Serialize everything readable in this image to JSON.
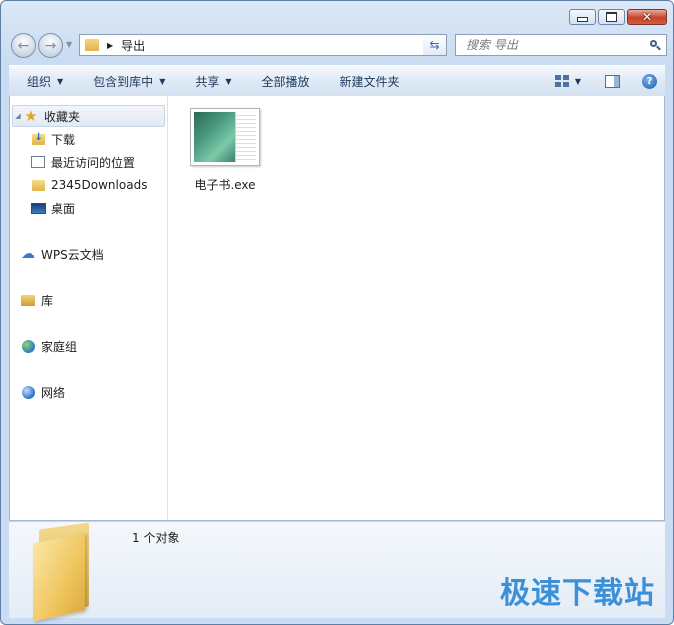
{
  "window": {
    "caption": {
      "minimize": "minimize",
      "maximize": "maximize",
      "close": "close"
    }
  },
  "navbar": {
    "breadcrumb": "导出",
    "search_placeholder": "搜索 导出"
  },
  "toolbar": {
    "organize": "组织",
    "include_in_library": "包含到库中",
    "share": "共享",
    "play_all": "全部播放",
    "new_folder": "新建文件夹",
    "help": "?"
  },
  "sidebar": {
    "favorites": "收藏夹",
    "favorites_items": [
      {
        "label": "下载",
        "icon": "download-folder-icon"
      },
      {
        "label": "最近访问的位置",
        "icon": "recent-places-icon"
      },
      {
        "label": "2345Downloads",
        "icon": "folder-icon"
      },
      {
        "label": "桌面",
        "icon": "desktop-icon"
      }
    ],
    "groups": [
      {
        "label": "WPS云文档",
        "icon": "cloud-icon"
      },
      {
        "label": "库",
        "icon": "library-icon"
      },
      {
        "label": "家庭组",
        "icon": "homegroup-icon"
      },
      {
        "label": "网络",
        "icon": "network-icon"
      }
    ]
  },
  "content": {
    "files": [
      {
        "name": "电子书.exe",
        "icon": "exe-thumbnail-icon"
      }
    ]
  },
  "details": {
    "object_count": "1 个对象"
  },
  "watermark": "极速下载站",
  "colors": {
    "accent": "#3b90d8",
    "window_frame": "#c9dcf1"
  }
}
